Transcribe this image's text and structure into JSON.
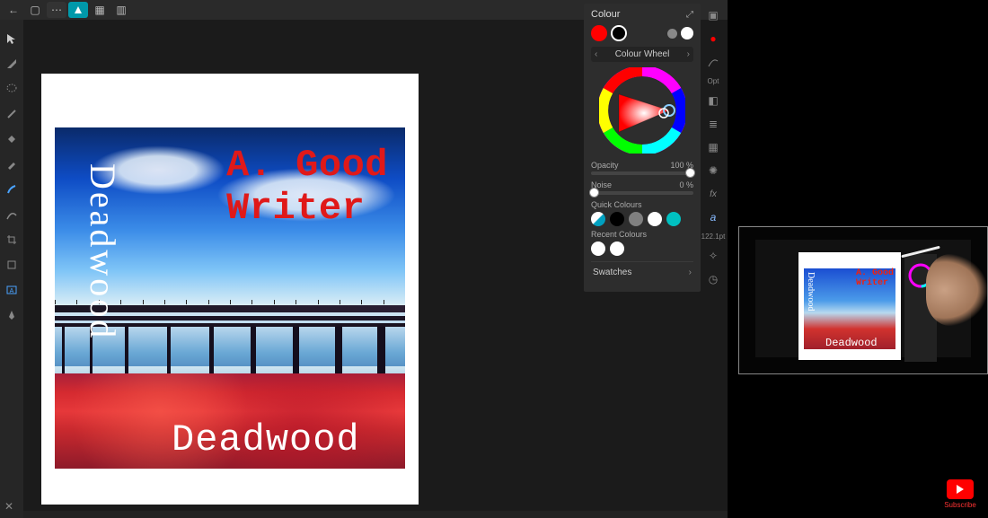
{
  "topbar": {
    "back": "←",
    "doc": "▢",
    "more": "⋯",
    "grid": "▦",
    "split": "▥"
  },
  "canvas": {
    "author_text": "A. Good\nWriter",
    "title_vertical": "Deadwood",
    "title_horizontal": "Deadwood"
  },
  "panel": {
    "title": "Colour",
    "mode": "Colour Wheel",
    "opacity_label": "Opacity",
    "opacity_value": "100 %",
    "noise_label": "Noise",
    "noise_value": "0 %",
    "quick_label": "Quick Colours",
    "quick": [
      "#00a0c0",
      "#000000",
      "#808080",
      "#ffffff",
      "#00c0c0"
    ],
    "recent_label": "Recent Colours",
    "recent": [
      "#ffffff",
      "#ffffff"
    ],
    "swatches": "Swatches",
    "primary": "#ff0000",
    "secondary": "#ffffff"
  },
  "sidetools": {
    "opt": "Opt",
    "size": "122.1pt"
  },
  "subscribe": "Subscribe",
  "preview": {
    "author": "A. Good\nWriter",
    "tv": "Deadwood",
    "th": "Deadwood"
  }
}
